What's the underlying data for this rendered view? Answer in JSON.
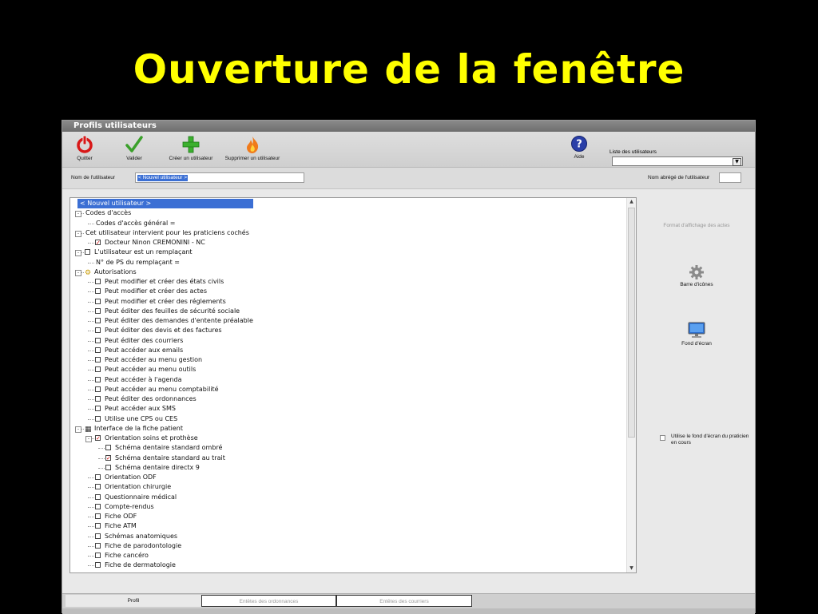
{
  "slide_title": "Ouverture de la fenêtre",
  "window": {
    "title": "Profils utilisateurs",
    "toolbar": {
      "quit": "Quitter",
      "validate": "Valider",
      "create_user": "Créer un utilisateur",
      "delete_user": "Supprimer un utilisateur",
      "help": "Aide",
      "user_list_label": "Liste des utilisateurs",
      "user_list_value": ""
    },
    "name_bar": {
      "username_label": "Nom de l'utilisateur",
      "username_value": "< Nouvel utilisateur >",
      "short_name_label": "Nom abrégé de l'utilisateur",
      "short_name_value": ""
    },
    "tree": [
      {
        "label": "< Nouvel utilisateur >",
        "level": 0,
        "selected": true
      },
      {
        "label": "Codes d'accès",
        "level": 0,
        "expander": "-"
      },
      {
        "label": "Codes d'accès général =",
        "level": 1
      },
      {
        "label": "Cet utilisateur intervient pour les praticiens cochés",
        "level": 0,
        "expander": "-"
      },
      {
        "label": "Docteur Ninon CREMONINI - NC",
        "level": 1,
        "checked": true
      },
      {
        "label": "L'utilisateur est un remplaçant",
        "level": 0,
        "expander": "-",
        "checked": false
      },
      {
        "label": "N° de PS du remplaçant =",
        "level": 1
      },
      {
        "label": "Autorisations",
        "level": 0,
        "expander": "-",
        "icon": "key-gear"
      },
      {
        "label": "Peut modifier et créer des états civils",
        "level": 1,
        "checked": false
      },
      {
        "label": "Peut modifier et créer des actes",
        "level": 1,
        "checked": false
      },
      {
        "label": "Peut modifier et créer des réglements",
        "level": 1,
        "checked": false
      },
      {
        "label": "Peut éditer des feuilles de sécurité sociale",
        "level": 1,
        "checked": false
      },
      {
        "label": "Peut éditer des demandes d'entente préalable",
        "level": 1,
        "checked": false
      },
      {
        "label": "Peut éditer des devis et des factures",
        "level": 1,
        "checked": false
      },
      {
        "label": "Peut éditer des courriers",
        "level": 1,
        "checked": false
      },
      {
        "label": "Peut accéder aux emails",
        "level": 1,
        "checked": false
      },
      {
        "label": "Peut accéder au menu gestion",
        "level": 1,
        "checked": false
      },
      {
        "label": "Peut accéder au menu outils",
        "level": 1,
        "checked": false
      },
      {
        "label": "Peut accéder à l'agenda",
        "level": 1,
        "checked": false
      },
      {
        "label": "Peut accéder au menu comptabilité",
        "level": 1,
        "checked": false
      },
      {
        "label": "Peut éditer des ordonnances",
        "level": 1,
        "checked": false
      },
      {
        "label": "Peut accéder aux SMS",
        "level": 1,
        "checked": false
      },
      {
        "label": "Utilise une CPS ou CES",
        "level": 1,
        "checked": false
      },
      {
        "label": "Interface de la fiche patient",
        "level": 0,
        "expander": "-",
        "icon": "patient-card"
      },
      {
        "label": "Orientation soins et prothèse",
        "level": 1,
        "expander": "-",
        "checked": true
      },
      {
        "label": "Schéma dentaire standard ombré",
        "level": 2,
        "checked": false
      },
      {
        "label": "Schéma dentaire standard au trait",
        "level": 2,
        "checked": true
      },
      {
        "label": "Schéma dentaire directx 9",
        "level": 2,
        "checked": false
      },
      {
        "label": "Orientation ODF",
        "level": 1,
        "checked": false
      },
      {
        "label": "Orientation chirurgie",
        "level": 1,
        "checked": false
      },
      {
        "label": "Questionnaire médical",
        "level": 1,
        "checked": false
      },
      {
        "label": "Compte-rendus",
        "level": 1,
        "checked": false
      },
      {
        "label": "Fiche ODF",
        "level": 1,
        "checked": false
      },
      {
        "label": "Fiche ATM",
        "level": 1,
        "checked": false
      },
      {
        "label": "Schémas anatomiques",
        "level": 1,
        "checked": false
      },
      {
        "label": "Fiche de parodontologie",
        "level": 1,
        "checked": false
      },
      {
        "label": "Fiche cancéro",
        "level": 1,
        "checked": false
      },
      {
        "label": "Fiche de dermatologie",
        "level": 1,
        "checked": false
      }
    ],
    "side_panel": {
      "display_format": "Format d'affichage des actes",
      "icon_bar": "Barre d'icônes",
      "wallpaper": "Fond d'écran",
      "use_practitioner_wallpaper": "Utilise le fond d'écran du praticien en cours"
    },
    "tabs": [
      {
        "label": "Profil",
        "active": true
      },
      {
        "label": "Entêtes des ordonnances",
        "active": false
      },
      {
        "label": "Entêtes des courriers",
        "active": false
      }
    ]
  },
  "colors": {
    "title_yellow": "#ffff00",
    "selection_blue": "#3b6fd4",
    "check_red": "#d00000"
  }
}
